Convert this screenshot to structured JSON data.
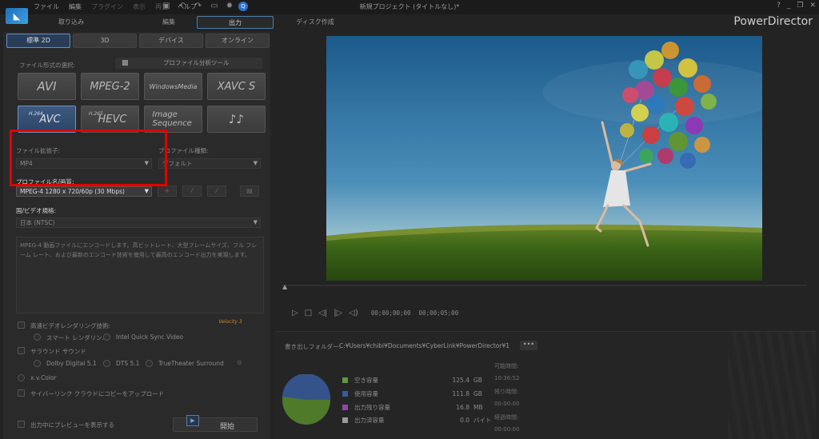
{
  "colors": {
    "accent": "#4a7fb0",
    "highlight_box": "#e00000",
    "velocity": "#c98a1a"
  },
  "titlebar": {
    "menus": [
      "ファイル",
      "編集",
      "プラグイン",
      "表示",
      "再生",
      "ヘルプ"
    ],
    "title": "新規プロジェクト (タイトルなし)*",
    "user_initial": "Q",
    "icons": [
      "save-icon",
      "settings-icon",
      "user-icon"
    ],
    "window_controls": [
      "?",
      "_",
      "❐",
      "✕"
    ]
  },
  "main_tabs": [
    {
      "label": "取り込み",
      "active": false
    },
    {
      "label": "編集",
      "active": false
    },
    {
      "label": "出力",
      "active": true
    },
    {
      "label": "ディスク作成",
      "active": false
    }
  ],
  "brand": "PowerDirector",
  "sub_tabs": [
    {
      "label": "標準 2D",
      "active": true
    },
    {
      "label": "3D",
      "active": false
    },
    {
      "label": "デバイス",
      "active": false
    },
    {
      "label": "オンライン",
      "active": false
    }
  ],
  "file_format": {
    "label": "ファイル形式の選択:",
    "analyzer_label": "プロファイル分析ツール",
    "formats": [
      {
        "label": "AVI",
        "sup": "",
        "selected": false
      },
      {
        "label": "MPEG-2",
        "sup": "",
        "selected": false
      },
      {
        "label": "WindowsMedia",
        "sup": "",
        "selected": false
      },
      {
        "label": "XAVC S",
        "sup": "",
        "selected": false
      },
      {
        "label": "AVC",
        "sup": "H.264",
        "selected": true
      },
      {
        "label": "HEVC",
        "sup": "H.265",
        "selected": false
      },
      {
        "label": "Image Sequence",
        "sup": "",
        "selected": false
      },
      {
        "label": "♪♪",
        "sup": "",
        "selected": false
      }
    ]
  },
  "extension": {
    "label": "ファイル拡張子:",
    "value": "MP4"
  },
  "profile_type": {
    "label": "プロファイル種類:",
    "value": "デフォルト"
  },
  "profile_name": {
    "label": "プロファイル名/画質:",
    "value": "MPEG-4 1280 x 720/60p (30 Mbps)"
  },
  "profile_buttons": [
    "+",
    "⁄",
    "⁄",
    "▤"
  ],
  "country": {
    "label": "国/ビデオ規格:",
    "value": "日本 (NTSC)"
  },
  "description": "MPEG-4 動画ファイルにエンコードします。高ビットレート、大型フレームサイズ、フル フレーム レート、および最新のエンコード技術を使用して最高のエンコード出力を実現します。",
  "options": {
    "fast_render": "高速ビデオレンダリング技術:",
    "smart_render": "スマート レンダリン...",
    "intel_qsv": "Intel Quick Sync Video",
    "surround": "サラウンド サウンド",
    "dolby": "Dolby Digital 5.1",
    "dts": "DTS 5.1",
    "truetheater": "TrueTheater Surround",
    "xvcolor": "x.v.Color",
    "cloud": "サイバーリンク クラウドにコピーをアップロード",
    "preview_while": "出力中にプレビューを表示する",
    "velocity": "Velocity 3"
  },
  "start_button": "開始",
  "player": {
    "controls": [
      "play-icon",
      "stop-icon",
      "prev-frame-icon",
      "next-frame-icon",
      "volume-icon"
    ],
    "timecode_current": "00;00;00;00",
    "timecode_total": "00;00;05;00"
  },
  "export": {
    "folder_label": "書き出しフォルダー:",
    "folder_path": "C:¥Users¥chibi¥Documents¥CyberLink¥PowerDirector¥1",
    "more": "•••",
    "disk": [
      {
        "name": "空き容量",
        "value": "125.4",
        "unit": "GB",
        "color": "#5a9a3a"
      },
      {
        "name": "使用容量",
        "value": "111.8",
        "unit": "GB",
        "color": "#3a5a9a"
      },
      {
        "name": "出力残り容量",
        "value": "16.8",
        "unit": "MB",
        "color": "#8a4aa0"
      },
      {
        "name": "出力済容量",
        "value": "0.0",
        "unit": "バイト",
        "color": "#9a9a9a"
      }
    ],
    "available_time_label": "可能時間:",
    "available_time": "10:36:52",
    "remaining_label": "残り時間:",
    "remaining": "00:00:00",
    "elapsed_label": "経過時間:",
    "elapsed": "00:00:00"
  }
}
